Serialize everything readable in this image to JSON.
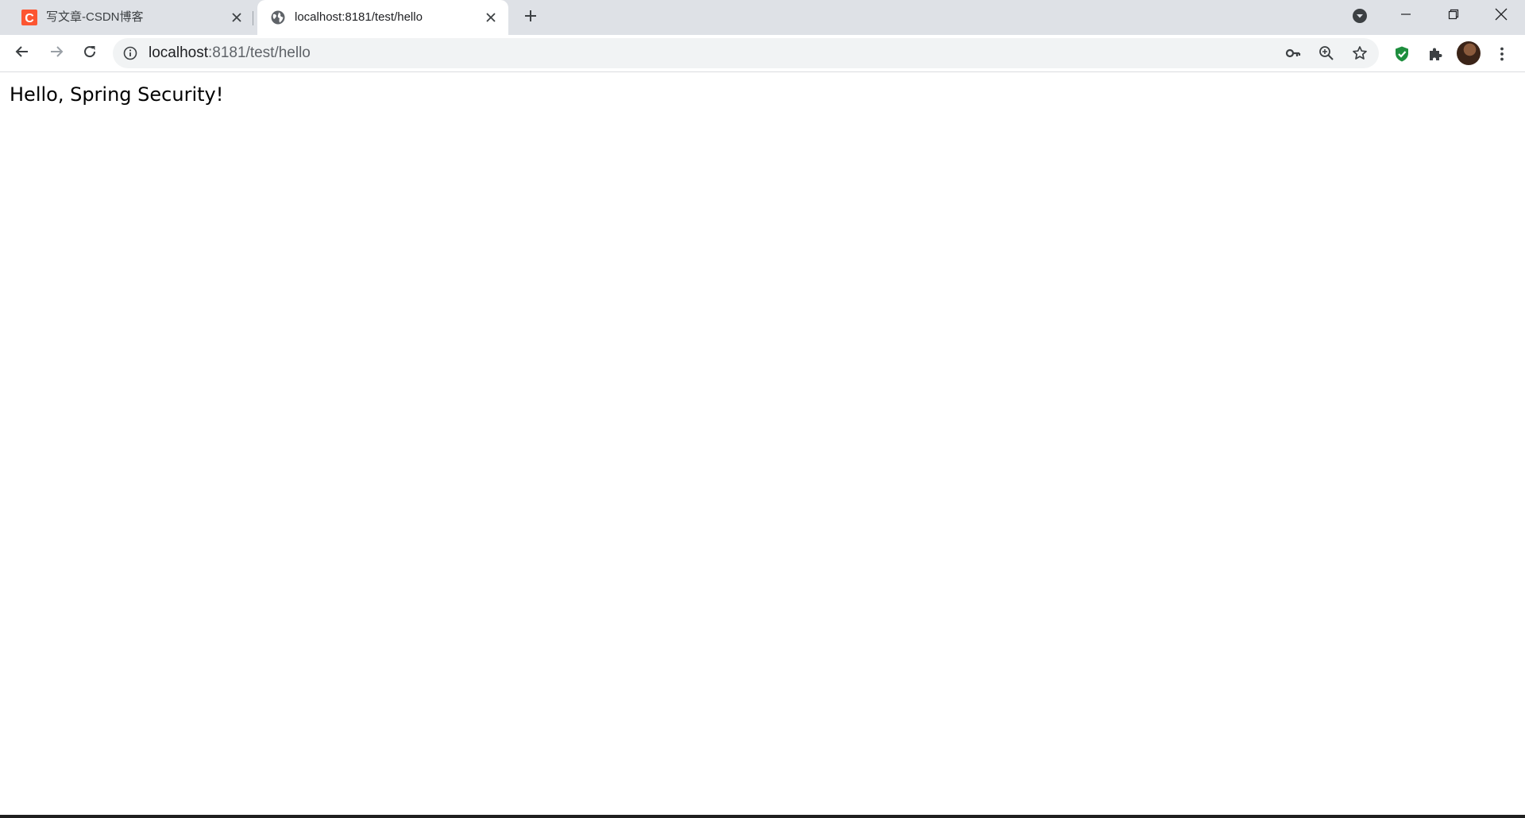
{
  "tabs": [
    {
      "title": "写文章-CSDN博客",
      "favicon": "csdn-logo-icon",
      "favicon_color": "#fc5531",
      "active": false
    },
    {
      "title": "localhost:8181/test/hello",
      "favicon": "globe-icon",
      "active": true
    }
  ],
  "toolbar": {
    "url_host": "localhost",
    "url_rest": ":8181/test/hello"
  },
  "page": {
    "text": "Hello, Spring Security!"
  },
  "colors": {
    "tabstrip_bg": "#dee1e6",
    "omnibox_bg": "#f1f3f4",
    "shield_green": "#1e8e3e",
    "csdn_red": "#fc5531"
  }
}
